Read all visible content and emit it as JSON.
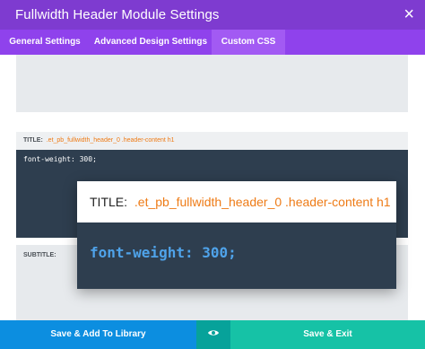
{
  "header": {
    "title": "Fullwidth Header Module Settings",
    "close_glyph": "×"
  },
  "tabs": [
    {
      "label": "General Settings",
      "active": false
    },
    {
      "label": "Advanced Design Settings",
      "active": false
    },
    {
      "label": "Custom CSS",
      "active": true
    }
  ],
  "fields": {
    "title": {
      "label": "TITLE:",
      "selector": ".et_pb_fullwidth_header_0 .header-content h1",
      "code": "font-weight: 300;"
    },
    "subtitle": {
      "label": "SUBTITLE:"
    }
  },
  "zoom": {
    "label": "TITLE:",
    "selector": ".et_pb_fullwidth_header_0 .header-content h1",
    "code_property": "font-weight:",
    "code_value": "300;"
  },
  "footer": {
    "library_label": "Save & Add To Library",
    "preview_icon": "eye-icon",
    "exit_label": "Save & Exit"
  },
  "colors": {
    "header_bg": "#7e3bd0",
    "tabs_bg": "#8f42ec",
    "active_tab_bg": "#a25af3",
    "code_bg": "#2e3e4f",
    "selector_orange": "#ee7b16",
    "library_btn": "#0c8ee0",
    "exit_btn": "#16c2a6"
  }
}
